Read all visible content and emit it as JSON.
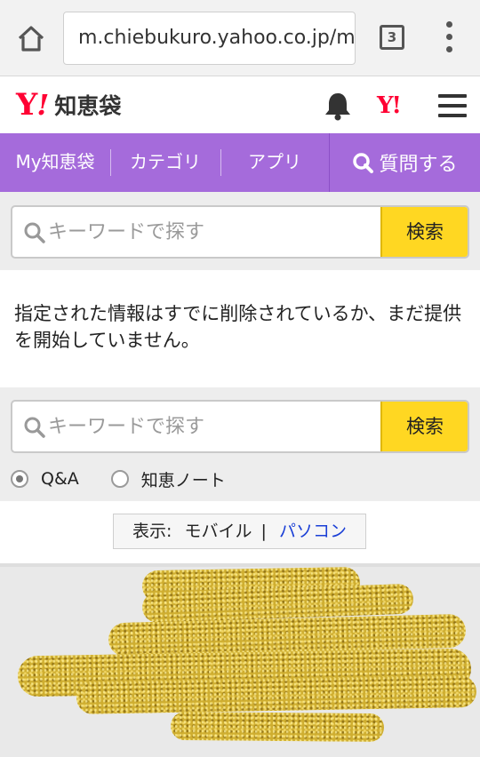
{
  "browser": {
    "url": "m.chiebukuro.yahoo.co.jp/m",
    "tab_count": "3",
    "icons": [
      "home-icon",
      "tabs-icon",
      "overflow-menu-icon"
    ]
  },
  "header": {
    "logo_y": "Y",
    "logo_excl": "!",
    "brand": "知恵袋",
    "yj_logo": "Y!",
    "icons": [
      "bell-icon",
      "hamburger-menu-icon"
    ]
  },
  "nav": {
    "items": [
      "My知恵袋",
      "カテゴリ",
      "アプリ"
    ],
    "ask_label": "質問する"
  },
  "search_top": {
    "placeholder": "キーワードで探す",
    "button": "検索"
  },
  "message": "指定された情報はすでに削除されているか、まだ提供を開始していません。",
  "search_bottom": {
    "placeholder": "キーワードで探す",
    "button": "検索"
  },
  "radios": [
    {
      "label": "Q&A",
      "selected": true
    },
    {
      "label": "知恵ノート",
      "selected": false
    }
  ],
  "display": {
    "prefix": "表示:",
    "mobile": "モバイル",
    "separator": "|",
    "pc_link": "パソコン"
  },
  "colors": {
    "nav_purple": "#a56bdb",
    "search_yellow": "#ffd722",
    "logo_red": "#ff0033",
    "link_blue": "#1a3fd6"
  }
}
